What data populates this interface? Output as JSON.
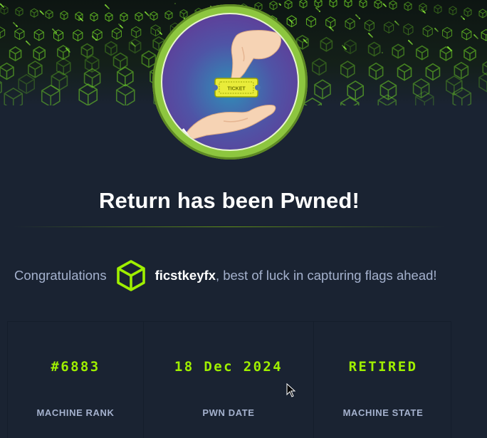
{
  "banner": {
    "icon": "green-cube-grid-pattern"
  },
  "avatar": {
    "icon": "ticket-handover-icon",
    "ticket_text": "TICKET"
  },
  "title": "Return has been Pwned!",
  "congrats": {
    "prefix": "Congratulations",
    "username": "ficstkeyfx",
    "suffix": ", best of luck in capturing flags ahead!",
    "user_icon": "cube-icon"
  },
  "stats": [
    {
      "value": "#6883",
      "label": "MACHINE RANK"
    },
    {
      "value": "18 Dec 2024",
      "label": "PWN DATE"
    },
    {
      "value": "RETIRED",
      "label": "MACHINE STATE"
    }
  ],
  "colors": {
    "background": "#1a2332",
    "accent": "#9fef00",
    "ring": "#8dc63f",
    "muted_text": "#a4b1cd"
  }
}
